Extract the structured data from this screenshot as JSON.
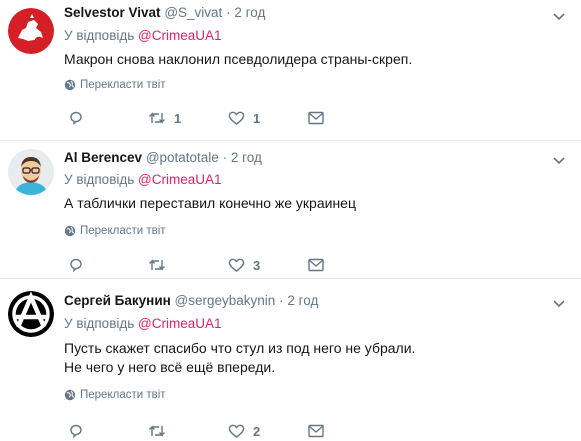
{
  "tweets": [
    {
      "name": "Selvestor Vivat",
      "handle": "@S_vivat",
      "dot": "·",
      "time": "2 год",
      "reply_prefix": "У відповідь",
      "reply_mention": "@CrimeaUA1",
      "text": "Макрон снова наклонил псевдолидера страны-скреп.",
      "translate_label": "Перекласти твіт",
      "reply_count": "",
      "retweet_count": "1",
      "like_count": "1",
      "avatar_icon": "knight-coat-of-arms-icon"
    },
    {
      "name": "Al Berencev",
      "handle": "@potatotale",
      "dot": "·",
      "time": "2 год",
      "reply_prefix": "У відповідь",
      "reply_mention": "@CrimeaUA1",
      "text": "А таблички переставил конечно же украинец",
      "translate_label": "Перекласти твіт",
      "reply_count": "",
      "retweet_count": "",
      "like_count": "3",
      "avatar_icon": "cartoon-man-icon"
    },
    {
      "name": "Сергей Бакунин",
      "handle": "@sergeybakynin",
      "dot": "·",
      "time": "2 год",
      "reply_prefix": "У відповідь",
      "reply_mention": "@CrimeaUA1",
      "text": "Пусть скажет спасибо что стул из под него не убрали.\nНе чего у него всё ещё впереди.",
      "translate_label": "Перекласти твіт",
      "reply_count": "",
      "retweet_count": "",
      "like_count": "2",
      "avatar_icon": "anarchy-symbol-icon"
    }
  ],
  "colors": {
    "mention": "#e0245e",
    "secondary": "#657786",
    "divider": "#e6ecf0"
  }
}
